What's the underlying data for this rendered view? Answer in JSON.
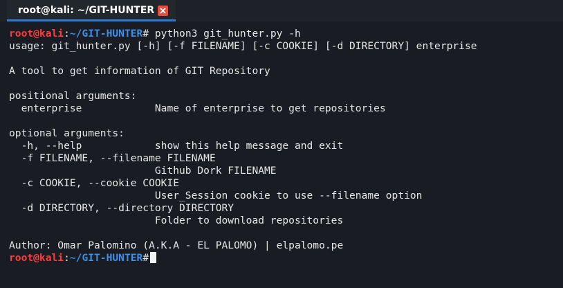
{
  "tab": {
    "title": "root@kali: ~/GIT-HUNTER"
  },
  "prompt": {
    "user": "root@kali",
    "sep": ":",
    "path": "~/GIT-HUNTER",
    "symbol": "#"
  },
  "command": " python3 git_hunter.py -h",
  "output": [
    "usage: git_hunter.py [-h] [-f FILENAME] [-c COOKIE] [-d DIRECTORY] enterprise",
    "",
    "A tool to get information of GIT Repository",
    "",
    "positional arguments:",
    "  enterprise            Name of enterprise to get repositories",
    "",
    "optional arguments:",
    "  -h, --help            show this help message and exit",
    "  -f FILENAME, --filename FILENAME",
    "                        Github Dork FILENAME",
    "  -c COOKIE, --cookie COOKIE",
    "                        User_Session cookie to use --filename option",
    "  -d DIRECTORY, --directory DIRECTORY",
    "                        Folder to download repositories",
    "",
    "Author: Omar Palomino (A.K.A - EL PALOMO) | elpalomo.pe"
  ],
  "colors": {
    "prompt_user": "#ff3b3b",
    "prompt_path": "#3f8fe8",
    "tab_underline": "#2f7bd8",
    "close_button": "#e74c3c"
  }
}
